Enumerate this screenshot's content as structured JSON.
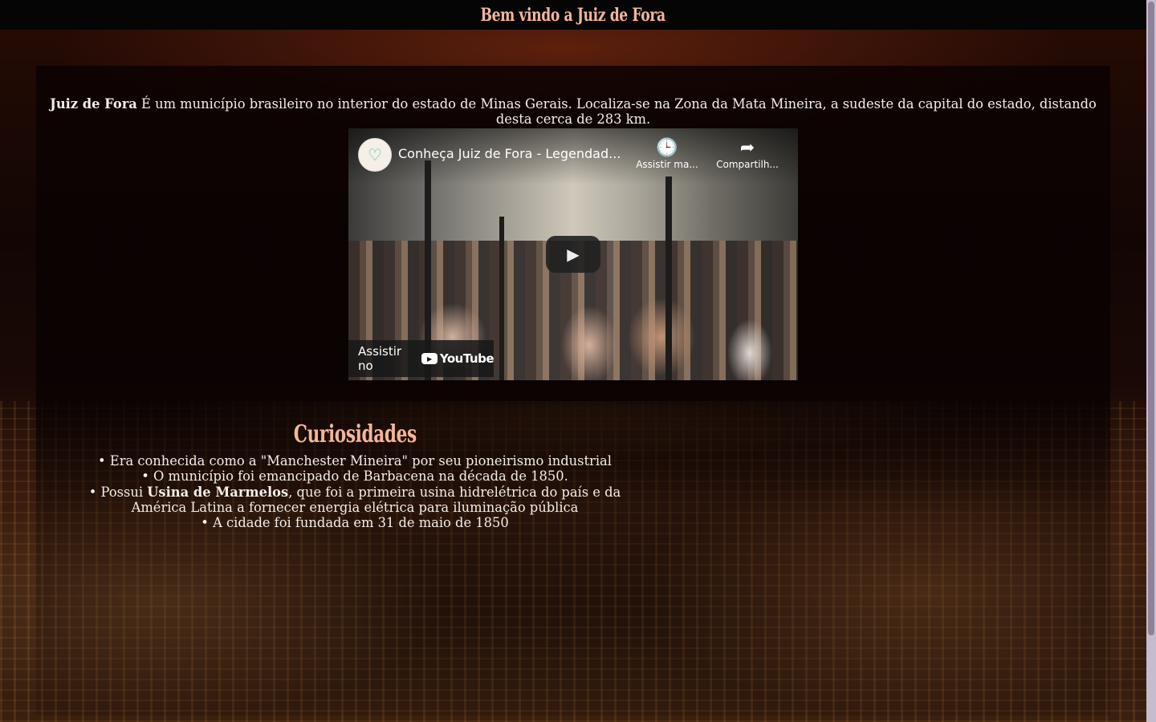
{
  "header": {
    "title": "Bem vindo a Juiz de Fora"
  },
  "intro": {
    "bold": "Juiz de Fora",
    "text": " É um município brasileiro no interior do estado de Minas Gerais. Localiza-se na Zona da Mata Mineira, a sudeste da capital do estado, distando desta cerca de 283 km."
  },
  "video": {
    "title": "Conheça Juiz de Fora - Legendad...",
    "watch_later_label": "Assistir ma...",
    "share_label": "Compartilh...",
    "watch_on_label": "Assistir no",
    "youtube_label": "YouTube"
  },
  "curiosidades": {
    "title": "Curiosidades",
    "items": [
      {
        "pre": "Era conhecida como a \"Manchester Mineira\" por seu pioneirismo industrial",
        "bold": "",
        "post": ""
      },
      {
        "pre": "O município foi emancipado de Barbacena na década de 1850.",
        "bold": "",
        "post": ""
      },
      {
        "pre": "Possui ",
        "bold": "Usina de Marmelos",
        "post": ", que foi a primeira usina hidrelétrica do país e da América Latina a fornecer energia elétrica para iluminação pública"
      },
      {
        "pre": "A cidade foi fundada em 31 de maio de 1850",
        "bold": "",
        "post": ""
      }
    ]
  },
  "colors": {
    "heading": "#f4b59a",
    "header_bg": "#050506",
    "text": "#f4eee8",
    "scrollbar": "#c6bccf"
  },
  "icons": [
    "heart-logo-icon",
    "clock-icon",
    "share-icon",
    "play-icon",
    "youtube-logo-icon"
  ]
}
